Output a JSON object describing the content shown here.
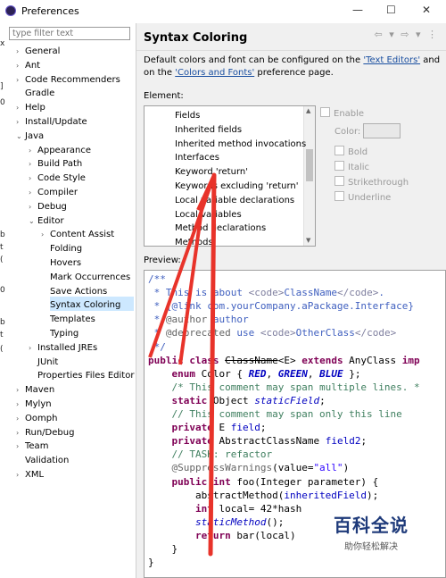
{
  "window": {
    "title": "Preferences",
    "minimize": "—",
    "maximize": "☐",
    "close": "✕"
  },
  "filter": {
    "placeholder": "type filter text"
  },
  "tree": [
    {
      "label": "General",
      "arrow": "›"
    },
    {
      "label": "Ant",
      "arrow": "›"
    },
    {
      "label": "Code Recommenders",
      "arrow": "›"
    },
    {
      "label": "Gradle",
      "arrow": ""
    },
    {
      "label": "Help",
      "arrow": "›"
    },
    {
      "label": "Install/Update",
      "arrow": "›"
    },
    {
      "label": "Java",
      "arrow": "⌄"
    },
    {
      "label": "Appearance",
      "arrow": "›"
    },
    {
      "label": "Build Path",
      "arrow": "›"
    },
    {
      "label": "Code Style",
      "arrow": "›"
    },
    {
      "label": "Compiler",
      "arrow": "›"
    },
    {
      "label": "Debug",
      "arrow": "›"
    },
    {
      "label": "Editor",
      "arrow": "⌄"
    },
    {
      "label": "Content Assist",
      "arrow": "›"
    },
    {
      "label": "Folding",
      "arrow": ""
    },
    {
      "label": "Hovers",
      "arrow": ""
    },
    {
      "label": "Mark Occurrences",
      "arrow": ""
    },
    {
      "label": "Save Actions",
      "arrow": ""
    },
    {
      "label": "Syntax Coloring",
      "arrow": ""
    },
    {
      "label": "Templates",
      "arrow": ""
    },
    {
      "label": "Typing",
      "arrow": ""
    },
    {
      "label": "Installed JREs",
      "arrow": "›"
    },
    {
      "label": "JUnit",
      "arrow": ""
    },
    {
      "label": "Properties Files Editor",
      "arrow": ""
    },
    {
      "label": "Maven",
      "arrow": "›"
    },
    {
      "label": "Mylyn",
      "arrow": "›"
    },
    {
      "label": "Oomph",
      "arrow": "›"
    },
    {
      "label": "Run/Debug",
      "arrow": "›"
    },
    {
      "label": "Team",
      "arrow": "›"
    },
    {
      "label": "Validation",
      "arrow": ""
    },
    {
      "label": "XML",
      "arrow": "›"
    }
  ],
  "page": {
    "title": "Syntax Coloring",
    "nav": "⇦ ▾  ⇨ ▾  ⋮",
    "desc_prefix": "Default colors and font can be configured on the ",
    "link1": "'Text Editors'",
    "desc_mid": " and on the ",
    "link2": "'Colors and Fonts'",
    "desc_suffix": " preference page.",
    "element_label": "Element:",
    "elements": [
      "Fields",
      "Inherited fields",
      "Inherited method invocations",
      "Interfaces",
      "Keyword 'return'",
      "Keywords excluding 'return'",
      "Local variable declarations",
      "Local variables",
      "Method declarations",
      "Methods"
    ],
    "enable_label": "Enable",
    "color_label": "Color:",
    "bold_label": "Bold",
    "italic_label": "Italic",
    "strike_label": "Strikethrough",
    "underline_label": "Underline",
    "preview_label": "Preview:"
  },
  "code": [
    [
      [
        "jd",
        "/**"
      ]
    ],
    [
      [
        "jd",
        " * This is about "
      ],
      [
        "tag",
        "<code>"
      ],
      [
        "jd",
        "ClassName"
      ],
      [
        "tag",
        "</code>"
      ],
      [
        "jd",
        "."
      ]
    ],
    [
      [
        "jd",
        " * {@link com.yourCompany.aPackage.Interface}"
      ]
    ],
    [
      [
        "jd",
        " * "
      ],
      [
        "ann",
        "@author"
      ],
      [
        "jd",
        " author"
      ]
    ],
    [
      [
        "jd",
        " * "
      ],
      [
        "ann",
        "@deprecated"
      ],
      [
        "jd",
        " use "
      ],
      [
        "tag",
        "<code>"
      ],
      [
        "jd",
        "OtherClass"
      ],
      [
        "tag",
        "</code>"
      ]
    ],
    [
      [
        "jd",
        " */"
      ]
    ],
    [
      [
        "kw",
        "public class "
      ],
      [
        "strike",
        "ClassName"
      ],
      [
        "n",
        "<E> "
      ],
      [
        "kw",
        "extends"
      ],
      [
        "n",
        " AnyClass "
      ],
      [
        "kw",
        "imp"
      ]
    ],
    [
      [
        "n",
        "    "
      ],
      [
        "kw",
        "enum"
      ],
      [
        "n",
        " Color { "
      ],
      [
        "en",
        "RED"
      ],
      [
        "n",
        ", "
      ],
      [
        "en",
        "GREEN"
      ],
      [
        "n",
        ", "
      ],
      [
        "en",
        "BLUE"
      ],
      [
        "n",
        " };"
      ]
    ],
    [
      [
        "cm",
        "    /* This comment may span multiple lines. *"
      ]
    ],
    [
      [
        "n",
        "    "
      ],
      [
        "kw",
        "static"
      ],
      [
        "n",
        " Object "
      ],
      [
        "st",
        "staticField"
      ],
      [
        "n",
        ";"
      ]
    ],
    [
      [
        "cm",
        "    // This comment may span only this line"
      ]
    ],
    [
      [
        "n",
        "    "
      ],
      [
        "kw",
        "private"
      ],
      [
        "n",
        " E "
      ],
      [
        "fld",
        "field"
      ],
      [
        "n",
        ";"
      ]
    ],
    [
      [
        "n",
        "    "
      ],
      [
        "kw",
        "private"
      ],
      [
        "n",
        " AbstractClassName "
      ],
      [
        "fld",
        "field2"
      ],
      [
        "n",
        ";"
      ]
    ],
    [
      [
        "cm",
        "    // TASK: refactor"
      ]
    ],
    [
      [
        "ann",
        "    @SuppressWarnings"
      ],
      [
        "n",
        "(value="
      ],
      [
        "str",
        "\"all\""
      ],
      [
        "n",
        ")"
      ]
    ],
    [
      [
        "n",
        "    "
      ],
      [
        "kw",
        "public int"
      ],
      [
        "n",
        " foo(Integer parameter) {"
      ]
    ],
    [
      [
        "n",
        "        abstractMethod("
      ],
      [
        "fld",
        "inheritedField"
      ],
      [
        "n",
        ");"
      ]
    ],
    [
      [
        "n",
        "        "
      ],
      [
        "kw",
        "int"
      ],
      [
        "n",
        " local= 42*hash"
      ]
    ],
    [
      [
        "n",
        "        "
      ],
      [
        "st",
        "staticMethod"
      ],
      [
        "n",
        "();"
      ]
    ],
    [
      [
        "n",
        "        "
      ],
      [
        "kw",
        "return"
      ],
      [
        "n",
        " bar(local)"
      ]
    ],
    [
      [
        "n",
        "    }"
      ]
    ],
    [
      [
        "n",
        "}"
      ]
    ]
  ],
  "watermark": {
    "title": "百科全说",
    "subtitle": "助你轻松解决"
  },
  "background_fragments": [
    "x",
    "]",
    "0",
    "b",
    "t",
    "(",
    "0",
    "b",
    "t",
    "("
  ],
  "colors": {
    "selection": "#cde8ff",
    "link": "#1a4fa0",
    "annotation_arrow": "#e8332a"
  }
}
